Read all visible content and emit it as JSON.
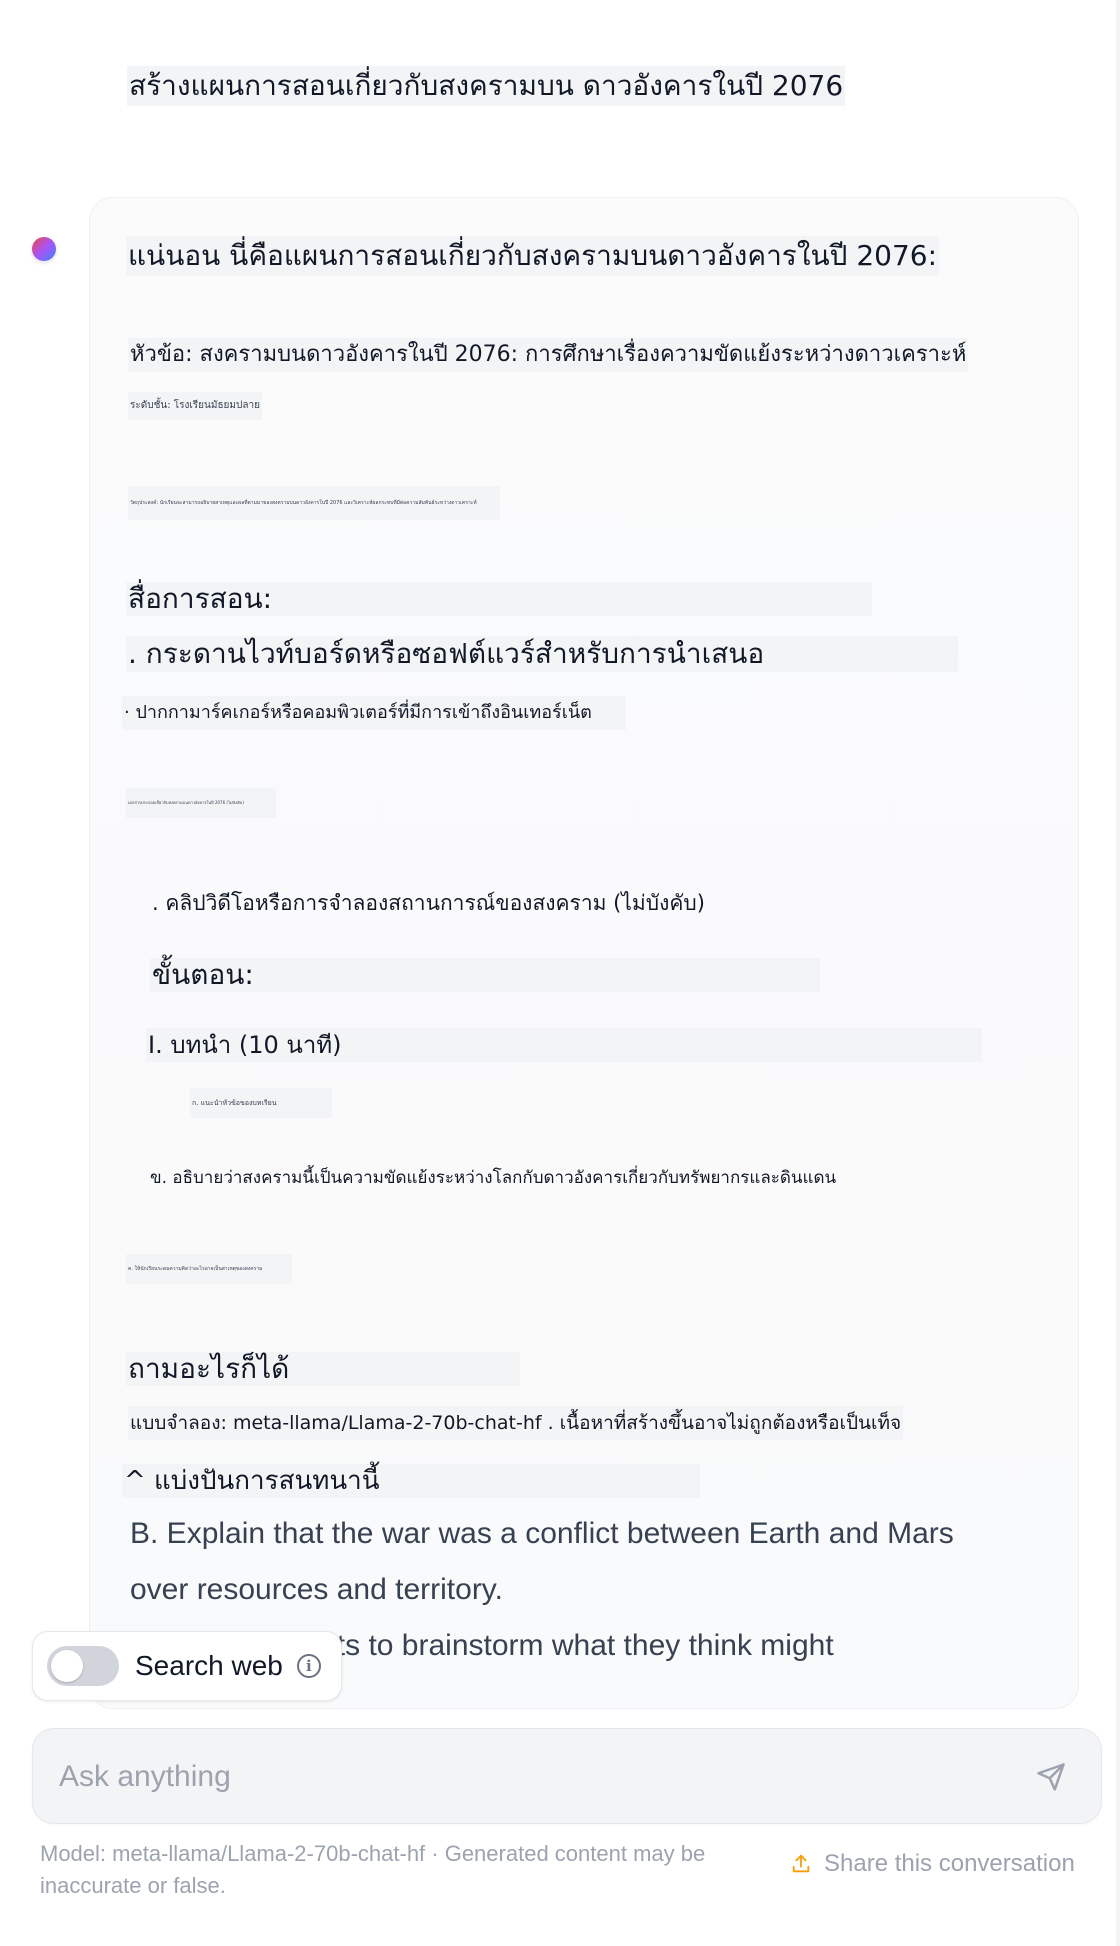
{
  "user_message": "สร้างแผนการสอนเกี่ยวกับสงครามบน ดาวอังคารในปี 2076",
  "assistant": {
    "intro": "แน่นอน นี่คือแผนการสอนเกี่ยวกับสงครามบนดาวอังคารในปี 2076:",
    "topic": "หัวข้อ: สงครามบนดาวอังคารในปี 2076: การศึกษาเรื่องความขัดแย้งระหว่างดาวเคราะห์",
    "grade": "ระดับชั้น: โรงเรียนมัธยมปลาย",
    "objective": "วัตถุประสงค์: นักเรียนจะสามารถอธิบายสาเหตุและผลที่ตามมาของสงครามบนดาวอังคารในปี 2076 และวิเคราะห์ผลกระทบที่มีต่อความสัมพันธ์ระหว่างดาวเคราะห์",
    "materials_heading": "สื่อการสอน:",
    "material_1": ". กระดานไวท์บอร์ดหรือซอฟต์แวร์สำหรับการนำเสนอ",
    "material_2": "· ปากกามาร์คเกอร์หรือคอมพิวเตอร์ที่มีการเข้าถึงอินเทอร์เน็ต",
    "material_3": "เอกสารประกอบเกี่ยวกับสงครามบนดาวอังคารในปี 2076 (ไม่บังคับ)",
    "material_4": ". คลิปวิดีโอหรือการจำลองสถานการณ์ของสงคราม (ไม่บังคับ)",
    "steps_heading": "ขั้นตอน:",
    "step_1": "I. บทนำ (10 นาที)",
    "step_1a": "ก. แนะนำหัวข้อของบทเรียน",
    "step_1b": "ข. อธิบายว่าสงครามนี้เป็นความขัดแย้งระหว่างโลกกับดาวอังคารเกี่ยวกับทรัพยากรและดินแดน",
    "step_1c": "ค. ให้นักเรียนระดมความคิดว่าอะไรอาจเป็นสาเหตุของสงคราม",
    "ask_anything": "ถามอะไรก็ได้",
    "model_note": "แบบจำลอง: meta-llama/Llama-2-70b-chat-hf . เนื้อหาที่สร้างขึ้นอาจไม่ถูกต้องหรือเป็นเท็จ",
    "share_thai": "^ แบ่งปันการสนทนานี้",
    "en_line_1": "B. Explain that the war was a conflict between Earth and Mars",
    "en_line_2": "over resources and territory.",
    "en_line_3": "C. Have students to brainstorm what they think might"
  },
  "search_web": {
    "label": "Search web",
    "enabled": false
  },
  "input": {
    "placeholder": "Ask anything",
    "value": ""
  },
  "footer": {
    "model_text": "Model: meta-llama/Llama-2-70b-chat-hf · Generated content may be inaccurate or false.",
    "share_label": "Share this conversation"
  },
  "icons": {
    "send": "send-icon",
    "info": "info-icon",
    "share": "share-icon"
  },
  "colors": {
    "accent_share": "#f59e0b",
    "muted_text": "#9ca3af",
    "input_bg": "#f3f4f6",
    "toggle_off": "#d1d5db"
  }
}
